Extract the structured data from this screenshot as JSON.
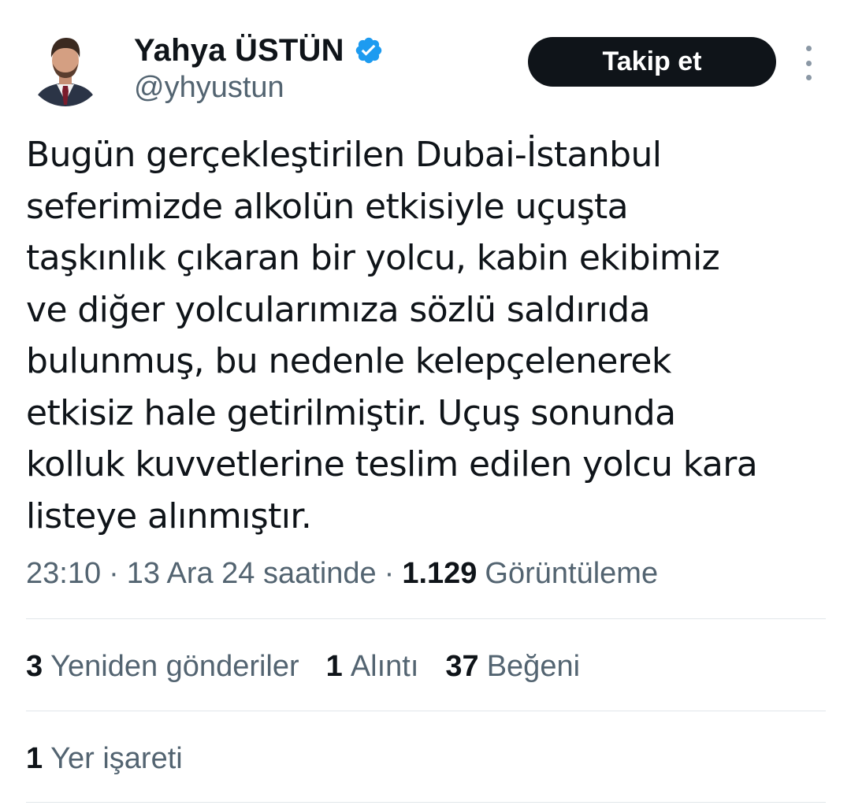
{
  "author": {
    "name": "Yahya ÜSTÜN",
    "handle": "@yhyustun",
    "verified": true,
    "avatar": "person-avatar"
  },
  "header": {
    "follow_label": "Takip et",
    "more_icon": "more-vertical-icon"
  },
  "tweet": {
    "lines": [
      "Bugün gerçekleştirilen Dubai-İstanbul",
      "seferimizde alkolün etkisiyle uçuşta",
      "taşkınlık çıkaran bir yolcu, kabin ekibimiz",
      "ve diğer yolcularımıza sözlü saldırıda",
      "bulunmuş, bu nedenle kelepçelenerek",
      "etkisiz hale getirilmiştir. Uçuş sonunda",
      "kolluk kuvvetlerine teslim edilen yolcu kara",
      "listeye alınmıştır."
    ]
  },
  "meta": {
    "time": "23:10",
    "separator": "·",
    "date": "13 Ara 24 saatinde",
    "views_count": "1.129",
    "views_label": "Görüntüleme"
  },
  "stats": {
    "reposts_count": "3",
    "reposts_label": "Yeniden gönderiler",
    "quotes_count": "1",
    "quotes_label": "Alıntı",
    "likes_count": "37",
    "likes_label": "Beğeni",
    "bookmarks_count": "1",
    "bookmarks_label": "Yer işareti"
  },
  "colors": {
    "text": "#0f1419",
    "secondary": "#536471",
    "verified": "#1d9bf0",
    "divider": "#e1e6ea",
    "button": "#0f1419"
  }
}
